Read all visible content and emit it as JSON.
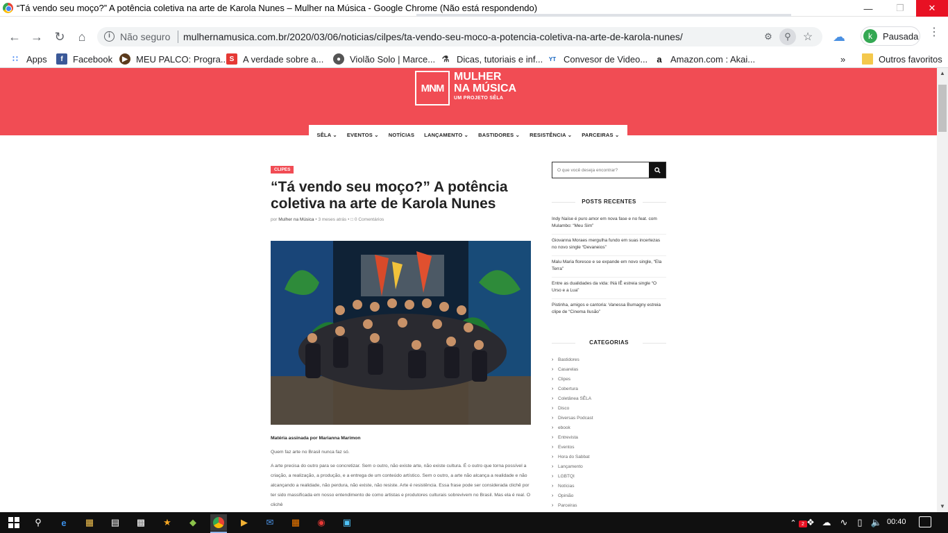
{
  "window": {
    "title": "“Tá vendo seu moço?” A potência coletiva na arte de Karola Nunes – Mulher na Música - Google Chrome (Não está respondendo)"
  },
  "toolbar": {
    "security_label": "Não seguro",
    "url": "mulhernamusica.com.br/2020/03/06/noticias/cilpes/ta-vendo-seu-moco-a-potencia-coletiva-na-arte-de-karola-nunes/",
    "profile_initial": "k",
    "profile_label": "Pausada"
  },
  "bookmarks": {
    "items": [
      {
        "label": "Apps",
        "icon": "apps-grid-icon"
      },
      {
        "label": "Facebook",
        "icon": "facebook-icon"
      },
      {
        "label": "MEU PALCO: Progra...",
        "icon": "meu-palco-icon"
      },
      {
        "label": "A verdade sobre a...",
        "icon": "s-logo-icon"
      },
      {
        "label": "Violão Solo | Marce...",
        "icon": "globe-icon"
      },
      {
        "label": "Dicas, tutoriais e inf...",
        "icon": "tutorial-icon"
      },
      {
        "label": "Convesor de Video...",
        "icon": "yt-mp3-icon"
      },
      {
        "label": "Amazon.com : Akai...",
        "icon": "amazon-icon"
      }
    ],
    "others_label": "Outros favoritos"
  },
  "site": {
    "logo_mark": "MNM",
    "logo_line1": "MULHER",
    "logo_line2": "NA MÚSICA",
    "logo_tagline": "UM PROJETO SÊLA",
    "brand_color": "#f14c54",
    "nav": [
      {
        "label": "SÊLA",
        "has_dropdown": true
      },
      {
        "label": "EVENTOS",
        "has_dropdown": true
      },
      {
        "label": "NOTÍCIAS",
        "has_dropdown": false
      },
      {
        "label": "LANÇAMENTO",
        "has_dropdown": true
      },
      {
        "label": "BASTIDORES",
        "has_dropdown": true
      },
      {
        "label": "RESISTÊNCIA",
        "has_dropdown": true
      },
      {
        "label": "PARCEIRAS",
        "has_dropdown": true
      }
    ]
  },
  "article": {
    "category": "CLIPES",
    "headline": "“Tá vendo seu moço?” A potência coletiva na arte de Karola Nunes",
    "meta_by": "por",
    "meta_author": "Mulher na Música",
    "meta_time": "3 meses atrás",
    "meta_comments": "0 Comentários",
    "byline": "Matéria assinada por Marianna Marimon",
    "paragraphs": [
      "Quem faz arte no Brasil nunca faz só.",
      "A arte precisa do outro para se concretizar. Sem o outro, não existe arte, não existe cultura. É o outro que torna possível a criação, a realização, a produção, e a entrega de um conteúdo artístico. Sem o outro, a arte não alcança a realidade e não alcançando a realidade, não perdura, não existe, não resiste. Arte é resistência. Essa frase pode ser considerada clichê por ter sido massificada em nosso entendimento de como artistas e produtores culturais sobrevivem no Brasil. Mas ela é real. O clichê"
    ]
  },
  "sidebar": {
    "search_placeholder": "O que você deseja encontrar?",
    "recent_title": "POSTS RECENTES",
    "recent_posts": [
      "Indy Naíse é puro amor em nova fase e no feat. com Mulambo: “Meu Sim”",
      "Giovanna Moraes mergulha fundo em suas incertezas no novo single “Devaneios”",
      "Malu Maria floresce e se expande em novo single, “Ela Terra”",
      "Entre as dualidades da vida: INá IÊ estreia single “O Urso e a Lua”",
      "Pistinha, amigos e cantoria: Vanessa Bumagny estreia clipe de “Cinema Ilusão”"
    ],
    "categories_title": "CATEGORIAS",
    "categories": [
      "Bastidores",
      "Casarelas",
      "Clipes",
      "Cobertura",
      "Coletânea SÊLA",
      "Disco",
      "Diversas Podcast",
      "ebook",
      "Entrevista",
      "Eventos",
      "Hora do Sabbat",
      "Lançamento",
      "LGBTQI",
      "Notícias",
      "Opinião",
      "Parceiras"
    ]
  },
  "taskbar": {
    "time": "00:40",
    "badge_count": "2"
  }
}
